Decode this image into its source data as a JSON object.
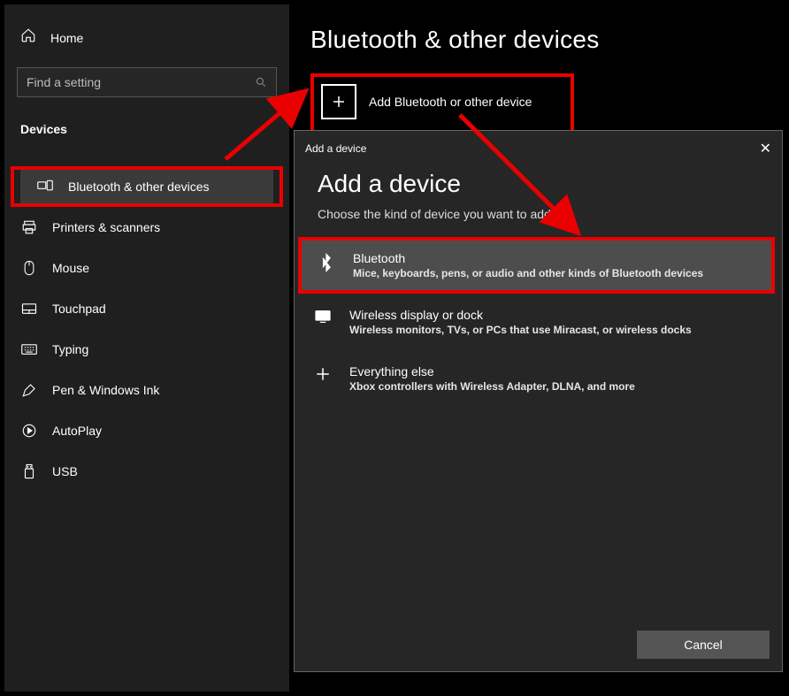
{
  "sidebar": {
    "home_label": "Home",
    "search_placeholder": "Find a setting",
    "section_header": "Devices",
    "items": [
      {
        "label": "Bluetooth & other devices",
        "selected": true,
        "highlighted": true,
        "icon": "devices"
      },
      {
        "label": "Printers & scanners",
        "icon": "printer"
      },
      {
        "label": "Mouse",
        "icon": "mouse"
      },
      {
        "label": "Touchpad",
        "icon": "touchpad"
      },
      {
        "label": "Typing",
        "icon": "keyboard"
      },
      {
        "label": "Pen & Windows Ink",
        "icon": "pen"
      },
      {
        "label": "AutoPlay",
        "icon": "autoplay"
      },
      {
        "label": "USB",
        "icon": "usb"
      }
    ]
  },
  "main": {
    "title": "Bluetooth & other devices",
    "add_device_label": "Add Bluetooth or other device"
  },
  "modal": {
    "header": "Add a device",
    "title": "Add a device",
    "subtitle": "Choose the kind of device you want to add",
    "options": [
      {
        "title": "Bluetooth",
        "desc": "Mice, keyboards, pens, or audio and other kinds of Bluetooth devices",
        "selected": true,
        "highlighted": true,
        "icon": "bluetooth"
      },
      {
        "title": "Wireless display or dock",
        "desc": "Wireless monitors, TVs, or PCs that use Miracast, or wireless docks",
        "icon": "display"
      },
      {
        "title": "Everything else",
        "desc": "Xbox controllers with Wireless Adapter, DLNA, and more",
        "icon": "plus"
      }
    ],
    "cancel_label": "Cancel"
  },
  "annotations": {
    "highlight_color": "#ea0000"
  }
}
